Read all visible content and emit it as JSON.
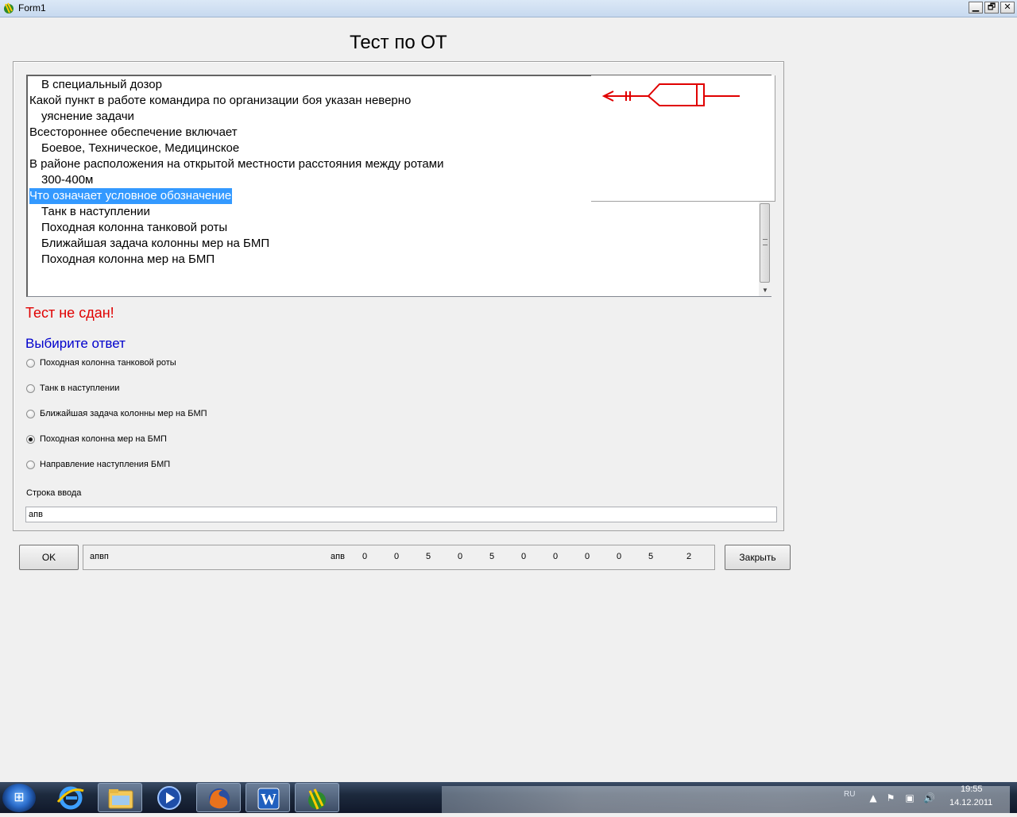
{
  "window": {
    "title": "Form1",
    "controls": {
      "minimize": "▁",
      "restore": "🗗",
      "close": "✕"
    }
  },
  "heading": "Тест по ОТ",
  "question_list": {
    "items": [
      {
        "text": "В специальный дозор",
        "indent": true,
        "selected": false
      },
      {
        "text": "Какой пункт в работе командира по организации боя указан неверно",
        "indent": false,
        "selected": false
      },
      {
        "text": "уяснение задачи",
        "indent": true,
        "selected": false
      },
      {
        "text": "Всестороннее обеспечение включает",
        "indent": false,
        "selected": false
      },
      {
        "text": "Боевое, Техническое, Медицинское",
        "indent": true,
        "selected": false
      },
      {
        "text": "В районе расположения на открытой местности расстояния между ротами",
        "indent": false,
        "selected": false
      },
      {
        "text": "300-400м",
        "indent": true,
        "selected": false
      },
      {
        "text": "Что означает условное обозначение",
        "indent": false,
        "selected": true
      },
      {
        "text": "Танк в наступлении",
        "indent": true,
        "selected": false
      },
      {
        "text": "Походная колонна танковой роты",
        "indent": true,
        "selected": false
      },
      {
        "text": "Ближайшая задача колонны мер на БМП",
        "indent": true,
        "selected": false
      },
      {
        "text": "Походная колонна мер на БМП",
        "indent": true,
        "selected": false
      }
    ],
    "symbol_color": "#e00000"
  },
  "result_text": "Тест не сдан!",
  "choose_label": "Выбирите ответ",
  "answers": [
    {
      "label": "Походная колонна танковой роты",
      "checked": false
    },
    {
      "label": "Танк в наступлении",
      "checked": false
    },
    {
      "label": "Ближайшая задача колонны мер на БМП",
      "checked": false
    },
    {
      "label": "Походная колонна мер на БМП",
      "checked": true
    },
    {
      "label": "Направление наступления БМП",
      "checked": false
    }
  ],
  "input": {
    "label": "Строка ввода",
    "value": "апв"
  },
  "buttons": {
    "ok": "OK",
    "close": "Закрыть"
  },
  "status": {
    "text": "апвп",
    "word": "апв",
    "numbers": [
      "0",
      "0",
      "5",
      "0",
      "5",
      "0",
      "0",
      "0",
      "0",
      "5",
      "2"
    ]
  },
  "taskbar": {
    "apps": [
      "internet-explorer",
      "file-explorer",
      "media-player",
      "firefox",
      "word",
      "form-app"
    ],
    "active_app": "form-app",
    "word_letter": "W",
    "language": "RU",
    "time": "19:55",
    "date": "14.12.2011"
  }
}
